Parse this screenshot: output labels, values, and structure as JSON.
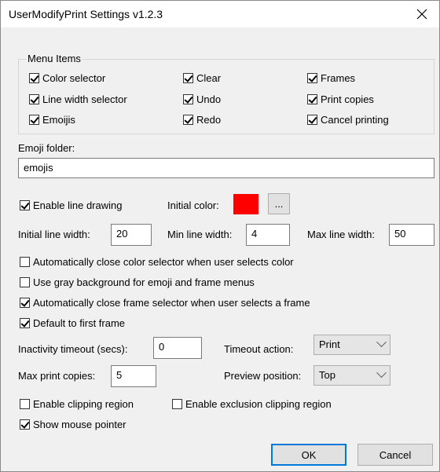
{
  "window": {
    "title": "UserModifyPrint Settings v1.2.3"
  },
  "menu_items": {
    "legend": "Menu Items",
    "items": [
      {
        "label": "Color selector",
        "checked": true
      },
      {
        "label": "Line width selector",
        "checked": true
      },
      {
        "label": "Emoijis",
        "checked": true
      },
      {
        "label": "Clear",
        "checked": true
      },
      {
        "label": "Undo",
        "checked": true
      },
      {
        "label": "Redo",
        "checked": true
      },
      {
        "label": "Frames",
        "checked": true
      },
      {
        "label": "Print copies",
        "checked": true
      },
      {
        "label": "Cancel printing",
        "checked": true
      }
    ]
  },
  "emoji_folder": {
    "label": "Emoji folder:",
    "value": "emojis"
  },
  "line_drawing": {
    "enable_label": "Enable line drawing",
    "enabled": true,
    "initial_color_label": "Initial color:",
    "initial_color": "#ff0000",
    "browse_label": "...",
    "initial_width_label": "Initial line width:",
    "initial_width": "20",
    "min_width_label": "Min line width:",
    "min_width": "4",
    "max_width_label": "Max line width:",
    "max_width": "50"
  },
  "options": [
    {
      "label": "Automatically close color selector when user selects color",
      "checked": false
    },
    {
      "label": "Use gray background for emoji and frame menus",
      "checked": false
    },
    {
      "label": "Automatically close frame selector when user selects a frame",
      "checked": true
    },
    {
      "label": "Default to first frame",
      "checked": true
    }
  ],
  "inactivity": {
    "label": "Inactivity timeout (secs):",
    "value": "0"
  },
  "timeout_action": {
    "label": "Timeout action:",
    "value": "Print"
  },
  "max_print": {
    "label": "Max print copies:",
    "value": "5"
  },
  "preview_position": {
    "label": "Preview position:",
    "value": "Top"
  },
  "clipping": {
    "enable_clipping_label": "Enable clipping region",
    "enable_clipping": false,
    "enable_exclusion_label": "Enable exclusion clipping region",
    "enable_exclusion": false,
    "show_pointer_label": "Show mouse pointer",
    "show_pointer": true
  },
  "buttons": {
    "ok": "OK",
    "cancel": "Cancel"
  }
}
